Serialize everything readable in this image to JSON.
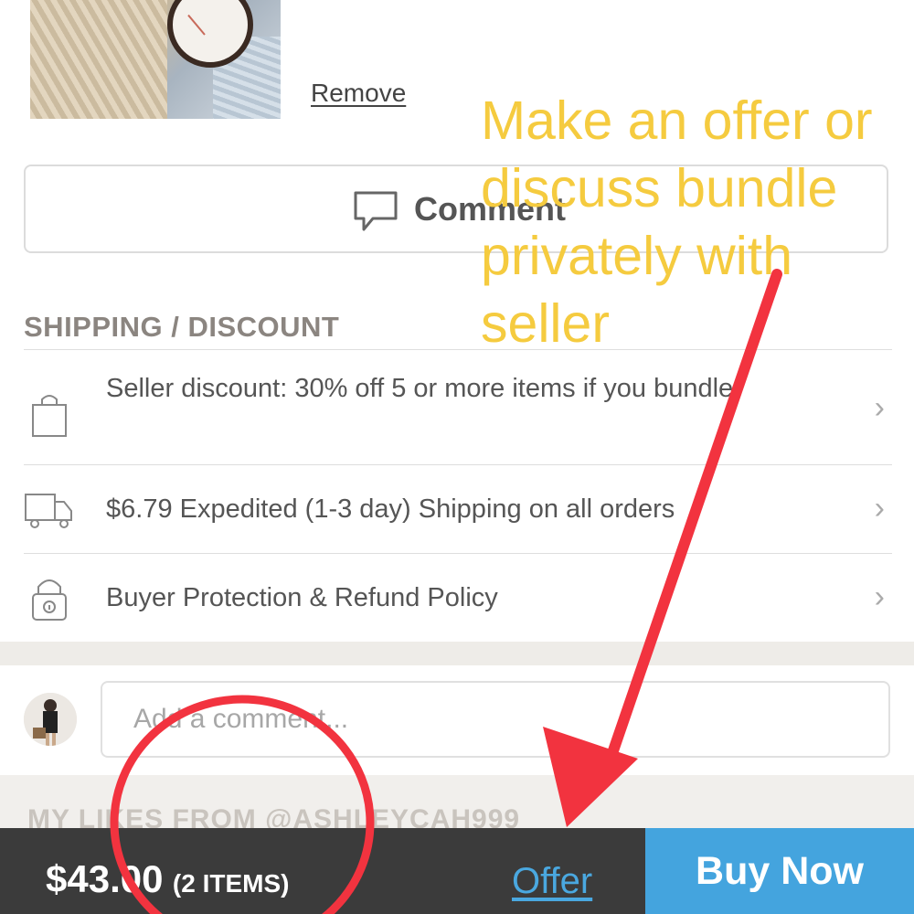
{
  "product": {
    "remove_label": "Remove"
  },
  "comment_button": {
    "label": "Comment",
    "icon": "speech-bubble-icon"
  },
  "shipping": {
    "title": "SHIPPING / DISCOUNT",
    "items": [
      {
        "icon": "shopping-bag-icon",
        "text": "Seller discount: 30% off 5 or more items if you bundle!"
      },
      {
        "icon": "delivery-truck-icon",
        "text": "$6.79 Expedited (1-3 day) Shipping on all orders"
      },
      {
        "icon": "padlock-icon",
        "text": "Buyer Protection & Refund Policy"
      }
    ],
    "chevron": "›"
  },
  "comment_input": {
    "placeholder": "Add a comment..."
  },
  "likes": {
    "heading": "MY LIKES FROM @ASHLEYCAH999"
  },
  "bottom_bar": {
    "price": "$43.00",
    "items": "(2 ITEMS)",
    "offer_label": "Offer",
    "buy_now_label": "Buy Now"
  },
  "annotation": {
    "text": "Make an offer or discuss bundle privately with seller",
    "color": "#f5cb3f",
    "marker_color": "#f2333f"
  },
  "colors": {
    "accent": "#44a4de",
    "bar": "#3b3b3b"
  }
}
